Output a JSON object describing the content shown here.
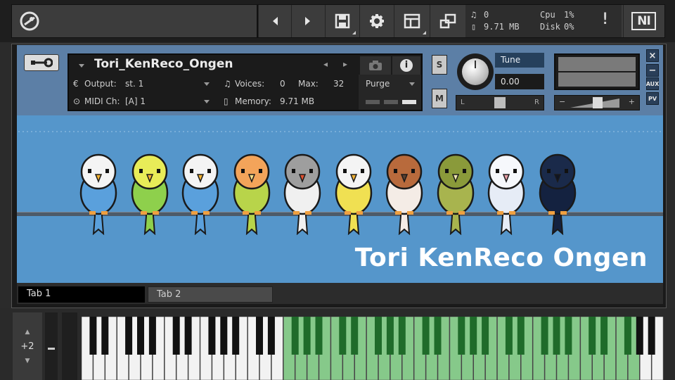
{
  "toolbar": {
    "icons": [
      "kontakt-logo-icon",
      "prev-icon",
      "next-icon",
      "save-icon",
      "gear-icon",
      "rack-view-icon",
      "minimize-view-icon",
      "warning-icon",
      "ni-logo-icon"
    ],
    "midi_activity": "0",
    "memory": "9.71 MB",
    "cpu_label": "Cpu",
    "cpu_value": "1%",
    "disk_label": "Disk",
    "disk_value": "0%",
    "warning": "!",
    "ni_logo": "NI"
  },
  "instrument": {
    "name": "Tori_KenReco_Ongen",
    "output_label": "Output:",
    "output_value": "st. 1",
    "voices_label": "Voices:",
    "voices_value": "0",
    "max_label": "Max:",
    "max_value": "32",
    "purge_label": "Purge",
    "midi_label": "MIDI Ch:",
    "midi_value": "[A]  1",
    "memory_label": "Memory:",
    "memory_value": "9.71 MB",
    "solo_label": "S",
    "mute_label": "M",
    "tune_label": "Tune",
    "tune_value": "0.00",
    "pan_left": "L",
    "pan_right": "R",
    "vol_minus": "−",
    "vol_plus": "+",
    "side_close": "×",
    "side_min": "−",
    "side_aux": "AUX",
    "side_pv": "PV"
  },
  "artwork": {
    "title": "Tori KenReco Ongen",
    "birds": [
      {
        "name": "white-budgie",
        "head": "#f4f4f4",
        "body": "#5aa0dc",
        "beak": "#f2b233"
      },
      {
        "name": "green-budgie",
        "head": "#e8ec58",
        "body": "#8ed04c",
        "beak": "#f2b233"
      },
      {
        "name": "blue-budgie",
        "head": "#f4f4f4",
        "body": "#5aa0dc",
        "beak": "#f2b233"
      },
      {
        "name": "lovebird",
        "head": "#f3a45a",
        "body": "#b8d44a",
        "beak": "#f6e08a"
      },
      {
        "name": "zebra-finch",
        "head": "#9e9e9e",
        "body": "#f0f0f0",
        "beak": "#e05030"
      },
      {
        "name": "yellow-budgie",
        "head": "#f4f4f4",
        "body": "#f0e052",
        "beak": "#f2b233"
      },
      {
        "name": "sparrow",
        "head": "#b86a3c",
        "body": "#f4ece6",
        "beak": "#5a4030"
      },
      {
        "name": "warbler",
        "head": "#8a9a3a",
        "body": "#a8b44e",
        "beak": "#f0e8b0"
      },
      {
        "name": "java-sparrow",
        "head": "#f6f8fc",
        "body": "#e6ecf6",
        "beak": "#e8a0a8"
      },
      {
        "name": "crow",
        "head": "#1a2a4a",
        "body": "#142240",
        "beak": "#0e1424"
      }
    ]
  },
  "tabs": [
    {
      "label": "Tab 1",
      "active": true
    },
    {
      "label": "Tab 2",
      "active": false
    }
  ],
  "keyboard": {
    "octave_shift": "+2",
    "octave_up": "▲",
    "octave_down": "▼",
    "highlight_color": "#86c98a",
    "mapped_start_white": 17,
    "mapped_end_white": 46
  }
}
